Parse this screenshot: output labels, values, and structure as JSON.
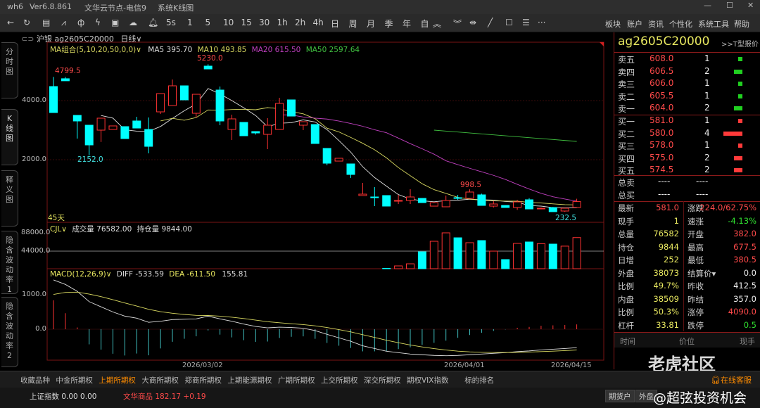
{
  "window": {
    "app": "wh6",
    "version": "Ver6.8.861",
    "node": "文华云节点-电信9",
    "view": "系统K线图"
  },
  "toolbar": {
    "periods": [
      "5s",
      "1",
      "5",
      "10",
      "15",
      "30",
      "1h",
      "2h",
      "4h",
      "日",
      "周",
      "月",
      "季",
      "年",
      "自"
    ],
    "menus": [
      "板块",
      "账户",
      "资讯",
      "个性化",
      "系统工具",
      "帮助"
    ]
  },
  "header": {
    "exchange": "沪银",
    "symbol": "ag2605C20000",
    "period": "日线∨"
  },
  "left_tabs": [
    "分时图",
    "K线图",
    "释义图",
    "隐含波动率1",
    "隐含波动率2"
  ],
  "ma_legend": {
    "label": "MA组合(5,10,20,50,0,0)∨",
    "ma5": "MA5 395.70",
    "ma10": "MA10 493.85",
    "ma20": "MA20 615.50",
    "ma50": "MA50 2597.64"
  },
  "annotations": {
    "high1": "4799.5",
    "low1": "2152.0",
    "high2": "5230.0",
    "high3": "998.5",
    "low2": "232.5",
    "days": "45天"
  },
  "axis": {
    "p4000": "4000.0",
    "p2000": "2000.0",
    "v88000": "88000.0",
    "v44000": "44000.0",
    "m1000": "1000.0",
    "m0": "0.0"
  },
  "volume_legend": {
    "label": "CJL∨",
    "vol": "成交量 76582.00",
    "oi": "持仓量 9844.00"
  },
  "macd_legend": {
    "label": "MACD(12,26,9)∨",
    "diff": "DIFF -533.59",
    "dea": "DEA -611.50",
    "macd": "155.81"
  },
  "dates": [
    "2026/03/02",
    "2026/04/01",
    "2026/04/15"
  ],
  "colors": {
    "up": "#ff3232",
    "down": "#00ffff",
    "ma5": "#e0e0e0",
    "ma10": "#d8d860",
    "ma20": "#c040c0",
    "ma50": "#40c040"
  },
  "candles": [
    [
      4476,
      4799.5,
      4476,
      3595
    ],
    [
      4740,
      4799.5,
      4670,
      4670
    ],
    [
      3500,
      3500,
      2714,
      3310
    ],
    [
      3167,
      3167,
      2152,
      2500
    ],
    [
      3000,
      3405,
      2600,
      3405
    ],
    [
      3024,
      3143,
      3024,
      3143
    ],
    [
      3119,
      3119,
      2714,
      2714
    ],
    [
      3310,
      3452,
      3071,
      3071
    ],
    [
      3024,
      3429,
      2214,
      2452
    ],
    [
      3619,
      4238,
      3548,
      4238
    ],
    [
      3833,
      4714,
      3833,
      4500
    ],
    [
      4500,
      4500,
      4024,
      4024
    ],
    [
      3571,
      4214,
      3429,
      4214
    ],
    [
      5167,
      5230,
      5071,
      5071
    ],
    [
      4357,
      4476,
      3167,
      3310
    ],
    [
      3024,
      3524,
      2667,
      3381
    ],
    [
      3262,
      3262,
      2810,
      2810
    ],
    [
      2952,
      2952,
      2850,
      2905
    ],
    [
      2857,
      3405,
      2357,
      3167
    ],
    [
      3024,
      4095,
      3024,
      3905
    ],
    [
      4024,
      4024,
      3476,
      3476
    ],
    [
      3167,
      3286,
      3000,
      3286
    ],
    [
      3190,
      3190,
      2548,
      2548
    ],
    [
      2381,
      2381,
      1810,
      1881
    ],
    [
      1952,
      2048,
      1952,
      2048
    ],
    [
      1857,
      1857,
      1381,
      1500
    ],
    [
      786,
      1214,
      786,
      833
    ],
    [
      738,
      1071,
      429,
      714
    ],
    [
      786,
      786,
      429,
      429
    ],
    [
      595,
      810,
      500,
      620
    ],
    [
      619,
      1000,
      500,
      738
    ],
    [
      690,
      690,
      547,
      547
    ],
    [
      428,
      547,
      428,
      547
    ],
    [
      405,
      786,
      405,
      619
    ],
    [
      714,
      810,
      640,
      690
    ],
    [
      690,
      998.5,
      690,
      905
    ],
    [
      810,
      850,
      452,
      452
    ],
    [
      428,
      600,
      380,
      500
    ],
    [
      452,
      452,
      381,
      381
    ],
    [
      381,
      640,
      300,
      571
    ],
    [
      643,
      700,
      333,
      333
    ],
    [
      333,
      380,
      320,
      357
    ],
    [
      381,
      400,
      240,
      240
    ],
    [
      262,
      357,
      232.5,
      357
    ],
    [
      382,
      677.5,
      380.5,
      581
    ]
  ],
  "ma50_segment": [
    3000,
    2619
  ],
  "volumes": [
    0,
    0,
    0,
    0,
    0,
    0,
    0,
    0,
    0,
    0,
    0,
    0,
    0,
    0,
    0,
    0,
    0,
    0,
    0,
    0,
    0,
    0,
    0,
    200,
    300,
    500,
    800,
    1500,
    2500,
    8460,
    13500,
    42300,
    67700,
    88000,
    76100,
    64300,
    69400,
    44000,
    23700,
    62600,
    66000,
    62000,
    60900,
    56000,
    76582
  ],
  "open_interest": 44000,
  "diff": [
    1430,
    1300,
    1100,
    800,
    650,
    500,
    380,
    320,
    200,
    230,
    280,
    290,
    300,
    380,
    300,
    230,
    150,
    80,
    40,
    60,
    50,
    30,
    -40,
    -150,
    -250,
    -350,
    -480,
    -560,
    -640,
    -680,
    -720,
    -740,
    -760,
    -770,
    -760,
    -740,
    -720,
    -700,
    -680,
    -650,
    -630,
    -600,
    -580,
    -560,
    -533.59
  ],
  "panel": {
    "title": "ag2605C20000",
    "t_quote": ">>T型报价",
    "asks": [
      {
        "label": "卖五",
        "price": "608.0",
        "qty": "1"
      },
      {
        "label": "卖四",
        "price": "606.5",
        "qty": "2"
      },
      {
        "label": "卖三",
        "price": "606.0",
        "qty": "1"
      },
      {
        "label": "卖二",
        "price": "605.5",
        "qty": "1"
      },
      {
        "label": "卖一",
        "price": "604.0",
        "qty": "2"
      }
    ],
    "bids": [
      {
        "label": "买一",
        "price": "581.0",
        "qty": "1"
      },
      {
        "label": "买二",
        "price": "580.0",
        "qty": "4"
      },
      {
        "label": "买三",
        "price": "578.0",
        "qty": "1"
      },
      {
        "label": "买四",
        "price": "575.0",
        "qty": "2"
      },
      {
        "label": "买五",
        "price": "574.5",
        "qty": "2"
      }
    ],
    "totals": [
      {
        "label": "总卖",
        "a": "----",
        "b": "----"
      },
      {
        "label": "总买",
        "a": "----",
        "b": "----"
      }
    ],
    "stats": [
      {
        "l1": "最新",
        "v1": "581.0",
        "c1": "red",
        "l2": "涨跌",
        "v2": "224.0/62.75%",
        "c2": "red"
      },
      {
        "l1": "现手",
        "v1": "1",
        "c1": "yel",
        "l2": "速涨",
        "v2": "-4.13%",
        "c2": "grn"
      },
      {
        "l1": "总量",
        "v1": "76582",
        "c1": "yel",
        "l2": "开盘",
        "v2": "382.0",
        "c2": "red"
      },
      {
        "l1": "持仓",
        "v1": "9844",
        "c1": "yel",
        "l2": "最高",
        "v2": "677.5",
        "c2": "red"
      },
      {
        "l1": "日增",
        "v1": "252",
        "c1": "yel",
        "l2": "最低",
        "v2": "380.5",
        "c2": "red"
      },
      {
        "l1": "外盘",
        "v1": "38073",
        "c1": "yel",
        "l2": "结算价▾",
        "v2": "0.0",
        "c2": "wht"
      },
      {
        "l1": "比例",
        "v1": "49.7%",
        "c1": "yel",
        "l2": "昨收",
        "v2": "412.5",
        "c2": "wht"
      },
      {
        "l1": "内盘",
        "v1": "38509",
        "c1": "yel",
        "l2": "昨结",
        "v2": "357.0",
        "c2": "wht"
      },
      {
        "l1": "比例",
        "v1": "50.3%",
        "c1": "yel",
        "l2": "涨停",
        "v2": "4090.0",
        "c2": "red"
      },
      {
        "l1": "杠杆",
        "v1": "33.81",
        "c1": "yel",
        "l2": "跌停",
        "v2": "0.5",
        "c2": "grn"
      }
    ],
    "trade_headers": [
      "时间",
      "价位",
      "现手"
    ]
  },
  "bottom_tabs": [
    "收藏品种",
    "中金所期权",
    "上期所期权",
    "大商所期权",
    "郑商所期权",
    "上期能源期权",
    "广期所期权",
    "上交所期权",
    "深交所期权",
    "期权VIX指数",
    "标的排名"
  ],
  "active_bottom_tab": 2,
  "service": "在线客服",
  "status": {
    "index": "上证指数 0.00 0.00",
    "commodity": "文华商品 182.17 +0.19",
    "btn1": "期货户",
    "btn2": "外盘"
  },
  "watermark": {
    "brand": "老虎社区",
    "handle": "@超弦投资机会"
  }
}
